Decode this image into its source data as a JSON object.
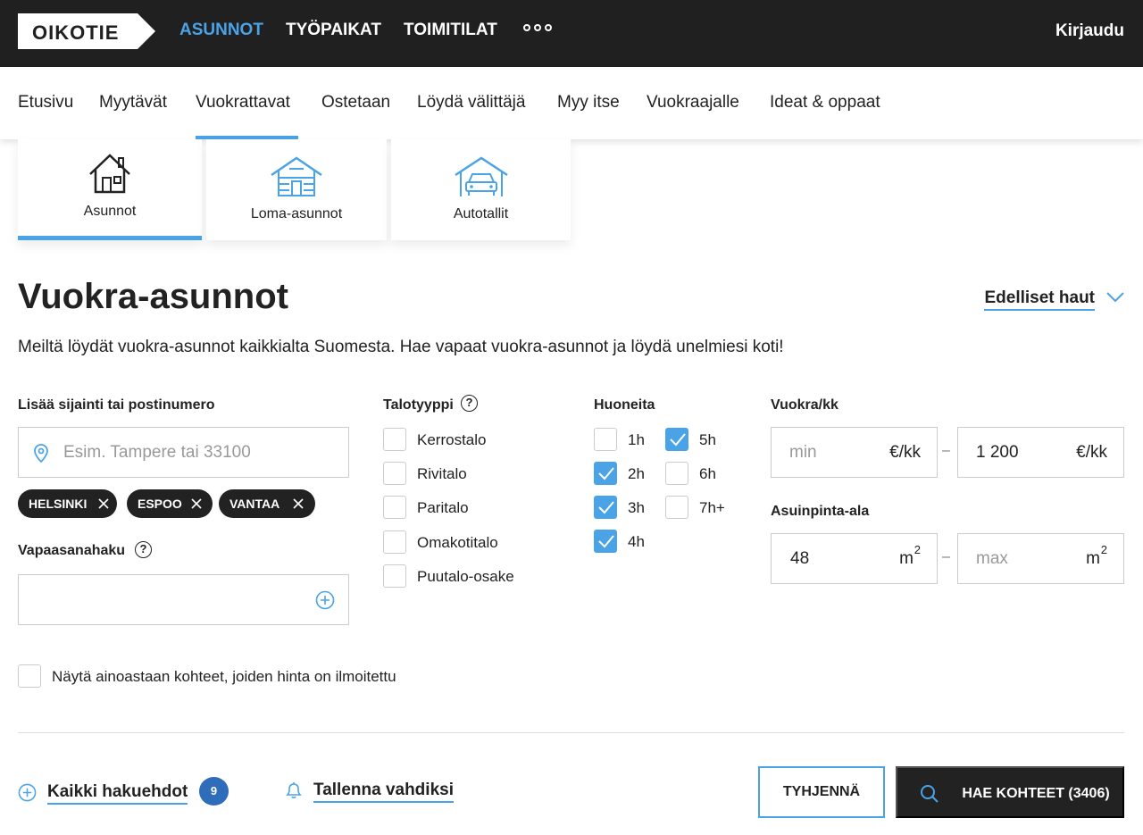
{
  "header": {
    "logo": "OIKOTIE",
    "nav": [
      "ASUNNOT",
      "TYÖPAIKAT",
      "TOIMITILAT"
    ],
    "login": "Kirjaudu"
  },
  "subnav": [
    "Etusivu",
    "Myytävät",
    "Vuokrattavat",
    "Ostetaan",
    "Löydä välittäjä",
    "Myy itse",
    "Vuokraajalle",
    "Ideat & oppaat"
  ],
  "property_tabs": [
    "Asunnot",
    "Loma-asunnot",
    "Autotallit"
  ],
  "page": {
    "title": "Vuokra-asunnot",
    "previous_searches": "Edelliset haut",
    "description": "Meiltä löydät vuokra-asunnot kaikkialta Suomesta. Hae vapaat vuokra-asunnot ja löydä unelmiesi koti!"
  },
  "location": {
    "label": "Lisää sijainti tai postinumero",
    "placeholder": "Esim. Tampere tai 33100",
    "chips": [
      "HELSINKI",
      "ESPOO",
      "VANTAA"
    ]
  },
  "freetext": {
    "label": "Vapaasanahaku"
  },
  "house_type": {
    "label": "Talotyyppi",
    "options": [
      "Kerrostalo",
      "Rivitalo",
      "Paritalo",
      "Omakotitalo",
      "Puutalo-osake"
    ]
  },
  "rooms": {
    "label": "Huoneita",
    "options": [
      {
        "label": "1h",
        "checked": false
      },
      {
        "label": "2h",
        "checked": true
      },
      {
        "label": "3h",
        "checked": true
      },
      {
        "label": "4h",
        "checked": true
      },
      {
        "label": "5h",
        "checked": true
      },
      {
        "label": "6h",
        "checked": false
      },
      {
        "label": "7h+",
        "checked": false
      }
    ]
  },
  "rent": {
    "label": "Vuokra/kk",
    "min_placeholder": "min",
    "max_value": "1 200",
    "unit": "€/kk",
    "dash": "–"
  },
  "area": {
    "label": "Asuinpinta-ala",
    "min_value": "48",
    "max_placeholder": "max",
    "unit": "m",
    "unit_sup": "2"
  },
  "price_only": "Näytä ainoastaan kohteet, joiden hinta on ilmoitettu",
  "footer": {
    "all_filters": "Kaikki hakuehdot",
    "filter_count": "9",
    "save_watch": "Tallenna vahdiksi",
    "clear": "TYHJENNÄ",
    "search": "HAE KOHTEET (3406)"
  },
  "colors": {
    "accent": "#4aa3e6",
    "dark": "#202020",
    "badge": "#2f6dbb"
  }
}
